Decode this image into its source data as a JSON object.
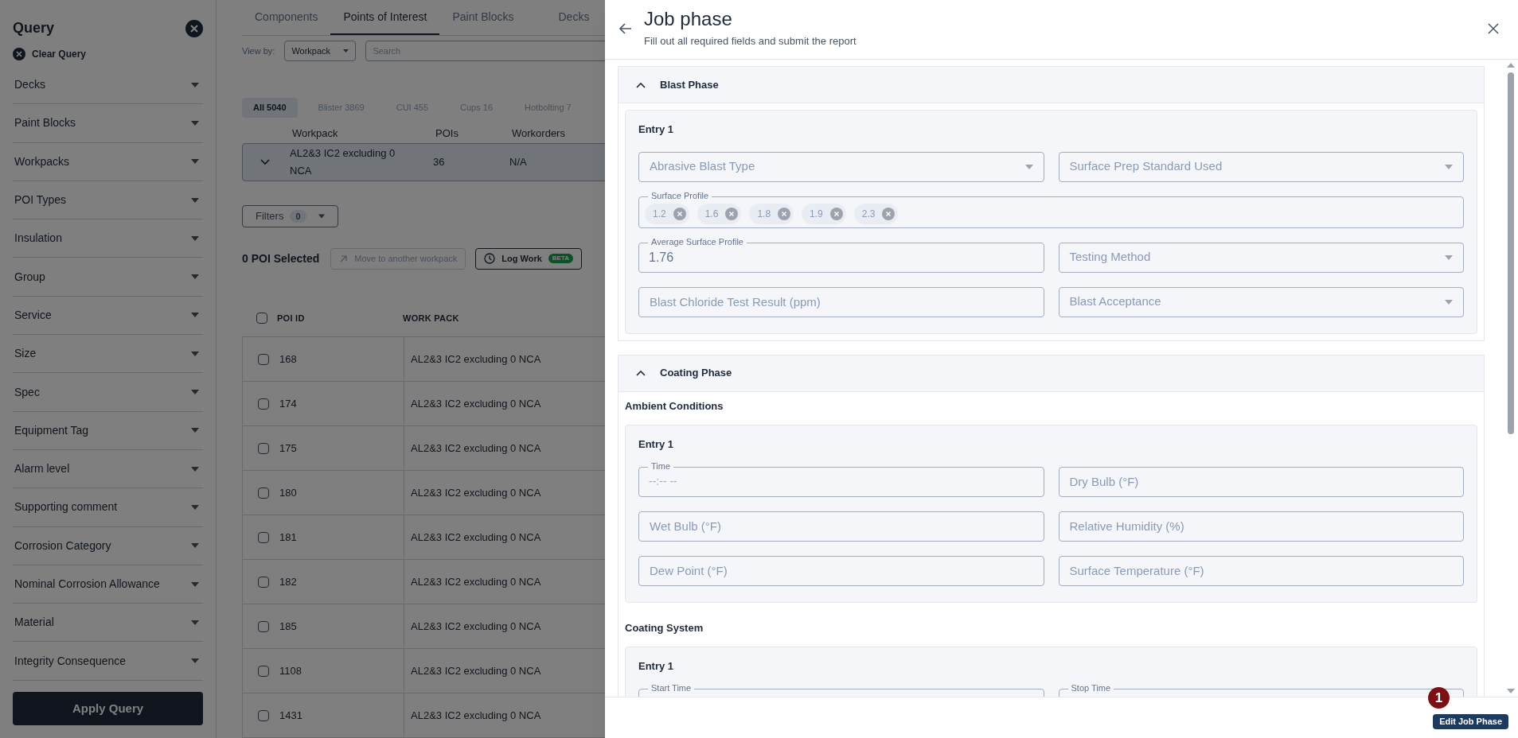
{
  "sidebar": {
    "title": "Query",
    "clear_label": "Clear Query",
    "items": [
      "Decks",
      "Paint Blocks",
      "Workpacks",
      "POI Types",
      "Insulation",
      "Group",
      "Service",
      "Size",
      "Spec",
      "Equipment Tag",
      "Alarm level",
      "Supporting comment",
      "Corrosion Category",
      "Nominal Corrosion Allowance",
      "Material",
      "Integrity Consequence"
    ],
    "apply_label": "Apply Query"
  },
  "tabs": [
    {
      "label": "Components",
      "selected": false
    },
    {
      "label": "Points of Interest",
      "selected": true
    },
    {
      "label": "Paint Blocks",
      "selected": false
    },
    {
      "label": "Decks",
      "selected": false
    }
  ],
  "view_by": {
    "label": "View by:",
    "value": "Workpack"
  },
  "search": {
    "placeholder": "Search"
  },
  "categories": [
    {
      "label": "All 5040",
      "selected": true
    },
    {
      "label": "Blister 3869",
      "selected": false
    },
    {
      "label": "CUI 455",
      "selected": false
    },
    {
      "label": "Cups 16",
      "selected": false
    },
    {
      "label": "Hotbolting 7",
      "selected": false
    }
  ],
  "workpack_table": {
    "columns": [
      "Workpack",
      "POIs",
      "Workorders"
    ],
    "rows": [
      {
        "workpack": "AL2&3 IC2 excluding 0 NCA",
        "pois": "36",
        "workorders": "N/A"
      }
    ]
  },
  "filters": {
    "label": "Filters",
    "count": "0"
  },
  "selection": {
    "label": "0 POI Selected",
    "actions": [
      {
        "label": "Move to another workpack",
        "disabled": true
      },
      {
        "label": "Log Work",
        "badge": "BETA",
        "disabled": false
      }
    ]
  },
  "poi_table": {
    "columns": [
      "POI ID",
      "WORK PACK"
    ],
    "all_checked": false,
    "rows": [
      {
        "poi_id": "168",
        "work_pack": "AL2&3 IC2 excluding 0 NCA",
        "checked": false
      },
      {
        "poi_id": "174",
        "work_pack": "AL2&3 IC2 excluding 0 NCA",
        "checked": false
      },
      {
        "poi_id": "175",
        "work_pack": "AL2&3 IC2 excluding 0 NCA",
        "checked": false
      },
      {
        "poi_id": "180",
        "work_pack": "AL2&3 IC2 excluding 0 NCA",
        "checked": false
      },
      {
        "poi_id": "181",
        "work_pack": "AL2&3 IC2 excluding 0 NCA",
        "checked": false
      },
      {
        "poi_id": "182",
        "work_pack": "AL2&3 IC2 excluding 0 NCA",
        "checked": false
      },
      {
        "poi_id": "185",
        "work_pack": "AL2&3 IC2 excluding 0 NCA",
        "checked": false
      },
      {
        "poi_id": "1108",
        "work_pack": "AL2&3 IC2 excluding 0 NCA",
        "checked": false
      },
      {
        "poi_id": "1431",
        "work_pack": "AL2&3 IC2 excluding 0 NCA",
        "checked": false
      }
    ]
  },
  "drawer": {
    "title": "Job phase",
    "subtitle": "Fill out all required fields and submit the report",
    "sections": [
      {
        "title": "Blast Phase",
        "expanded": true,
        "groups": [
          {
            "entries": [
              {
                "title": "Entry 1",
                "fields": [
                  {
                    "kind": "select",
                    "placeholder": "Abrasive Blast Type"
                  },
                  {
                    "kind": "select",
                    "placeholder": "Surface Prep Standard Used"
                  },
                  {
                    "kind": "chips",
                    "label": "Surface Profile",
                    "chips": [
                      "1.2",
                      "1.6",
                      "1.8",
                      "1.9",
                      "2.3"
                    ]
                  },
                  {
                    "kind": "text",
                    "label": "Average Surface Profile",
                    "value": "1.76"
                  },
                  {
                    "kind": "select",
                    "placeholder": "Testing Method"
                  },
                  {
                    "kind": "text",
                    "placeholder": "Blast Chloride Test Result (ppm)"
                  },
                  {
                    "kind": "select",
                    "placeholder": "Blast Acceptance"
                  }
                ]
              }
            ]
          }
        ]
      },
      {
        "title": "Coating Phase",
        "expanded": true,
        "groups": [
          {
            "title": "Ambient Conditions",
            "entries": [
              {
                "title": "Entry 1",
                "fields": [
                  {
                    "kind": "time",
                    "label": "Time",
                    "value": "--:-- --"
                  },
                  {
                    "kind": "text",
                    "placeholder": "Dry Bulb (°F)"
                  },
                  {
                    "kind": "text",
                    "placeholder": "Wet Bulb (°F)"
                  },
                  {
                    "kind": "text",
                    "placeholder": "Relative Humidity (%)"
                  },
                  {
                    "kind": "text",
                    "placeholder": "Dew Point (°F)"
                  },
                  {
                    "kind": "text",
                    "placeholder": "Surface Temperature (°F)"
                  }
                ]
              }
            ]
          },
          {
            "title": "Coating System",
            "entries": [
              {
                "title": "Entry 1",
                "fields": [
                  {
                    "kind": "time",
                    "label": "Start Time"
                  },
                  {
                    "kind": "time",
                    "label": "Stop Time"
                  }
                ]
              }
            ]
          }
        ]
      }
    ],
    "footer": {
      "button": "Edit Job Phase",
      "badge": "1"
    }
  }
}
